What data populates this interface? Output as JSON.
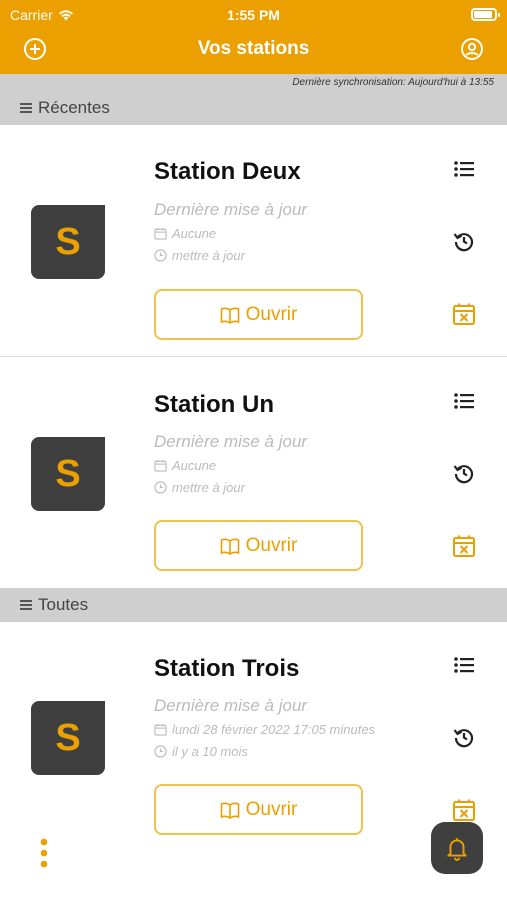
{
  "status_bar": {
    "carrier": "Carrier",
    "time": "1:55 PM"
  },
  "header": {
    "title": "Vos stations",
    "left_icon": "add-circle-icon",
    "right_icon": "account-icon"
  },
  "sync_text": "Dernière synchronisation: Aujourd'hui à 13:55",
  "sections": {
    "recent": "Récentes",
    "all": "Toutes"
  },
  "stations": [
    {
      "logo_letter": "S",
      "name": "Station Deux",
      "subtitle": "Dernière mise à jour",
      "date": "Aucune",
      "ago": "mettre à jour",
      "open_label": "Ouvrir"
    },
    {
      "logo_letter": "S",
      "name": "Station Un",
      "subtitle": "Dernière mise à jour",
      "date": "Aucune",
      "ago": "mettre à jour",
      "open_label": "Ouvrir"
    },
    {
      "logo_letter": "S",
      "name": "Station Trois",
      "subtitle": "Dernière mise à jour",
      "date": "lundi 28 février 2022 17:05 minutes",
      "ago": "il y a 10 mois",
      "open_label": "Ouvrir"
    }
  ],
  "colors": {
    "accent": "#eba000",
    "header_bg": "#eba000",
    "section_bg": "#cfcfcf",
    "logo_bg": "#3f3f3f"
  }
}
